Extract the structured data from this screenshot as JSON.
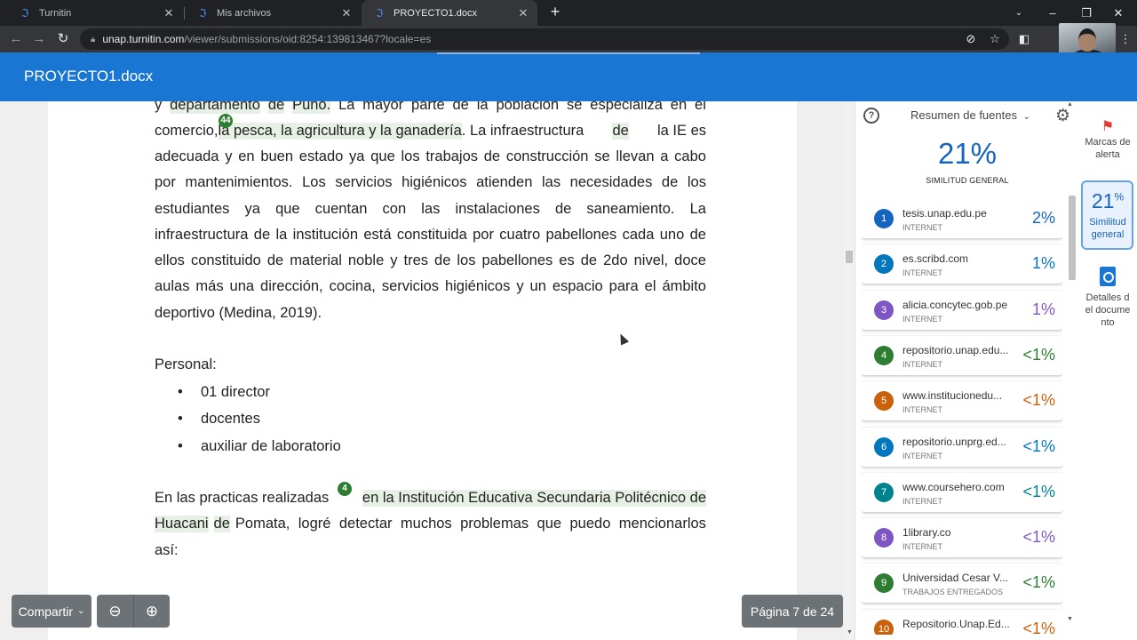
{
  "browser": {
    "tabs": [
      {
        "label": "Turnitin",
        "close": "✕"
      },
      {
        "label": "Mis archivos",
        "close": "✕"
      },
      {
        "label": "PROYECTO1.docx",
        "close": "✕"
      }
    ],
    "new_tab": "+",
    "url_host": "unap.turnitin.com",
    "url_path": "/viewer/submissions/oid:8254:139813467?locale=es"
  },
  "header": {
    "title": "PROYECTO1.docx"
  },
  "document": {
    "line1": [
      "y",
      "departamento",
      "de",
      "Puno.",
      "La",
      "mayor",
      "parte",
      "de",
      "la",
      "población",
      "se",
      "especializa",
      "en",
      "el"
    ],
    "line2_pre": "comercio,",
    "line2_hl": "la pesca, la agricultura y la ganadería",
    "line2_post": ". La infraestructura",
    "line2_hl2": "de",
    "line2_end": "la IE es",
    "line3": [
      "adecuada",
      "y",
      "en",
      "buen",
      "estado",
      "ya",
      "que",
      "los",
      "trabajos",
      "de",
      "construcción",
      "se",
      "llevan",
      "a",
      "cabo"
    ],
    "line4": [
      "por",
      "mantenimientos.",
      "Los",
      "servicios",
      "higiénicos",
      "atienden",
      "las",
      "necesidades",
      "de",
      "los"
    ],
    "line5": [
      "estudiantes",
      "ya",
      "que",
      "cuentan",
      "con",
      "las",
      "instalaciones",
      "de",
      "saneamiento.",
      "La"
    ],
    "line6": [
      "infraestructura",
      "de",
      "la",
      "institución",
      "está",
      "constituida",
      "por",
      "cuatro",
      "pabellones",
      "cada",
      "uno",
      "de"
    ],
    "line7": [
      "ellos",
      "constituido",
      "de",
      "material",
      "noble",
      "y",
      "tres",
      "de",
      "los",
      "pabellones",
      "es",
      "de",
      "2do",
      "nivel,",
      "doce"
    ],
    "line8": [
      "aulas",
      "más",
      "una",
      "dirección,",
      "cocina,",
      "servicios",
      "higiénicos",
      "y",
      "un",
      "espacio",
      "para",
      "el",
      "ámbito"
    ],
    "line9": "deportivo (Medina, 2019).",
    "personal_heading": "Personal:",
    "bullets": [
      "01 director",
      "docentes",
      "auxiliar de laboratorio"
    ],
    "para2_line1_pre": "En las practicas realizadas",
    "para2_line1_hl": "en la Institución Educativa Secundaria Politécnico de",
    "para2_line2_hl": "Huacani",
    "para2_line2_mid": "de",
    "para2_line2_post": "Pomata, logré detectar muchos problemas que puedo mencionarlos",
    "para2_line3": "así:",
    "marker_a": "44",
    "marker_b": "4"
  },
  "controls": {
    "share": "Compartir",
    "page_indicator": "Página 7 de 24"
  },
  "panel": {
    "summary_label": "Resumen de fuentes",
    "overall_pct": "21%",
    "overall_label": "SIMILITUD GENERAL",
    "sources": [
      {
        "n": "1",
        "name": "tesis.unap.edu.pe",
        "type": "INTERNET",
        "pct": "2%",
        "color": "#1565c0",
        "pct_color": "#1565c0"
      },
      {
        "n": "2",
        "name": "es.scribd.com",
        "type": "INTERNET",
        "pct": "1%",
        "color": "#0277bd",
        "pct_color": "#0277bd"
      },
      {
        "n": "3",
        "name": "alicia.concytec.gob.pe",
        "type": "INTERNET",
        "pct": "1%",
        "color": "#7e57c2",
        "pct_color": "#7e57c2"
      },
      {
        "n": "4",
        "name": "repositorio.unap.edu...",
        "type": "INTERNET",
        "pct": "<1%",
        "color": "#2e7d32",
        "pct_color": "#2e7d32"
      },
      {
        "n": "5",
        "name": "www.institucionedu...",
        "type": "INTERNET",
        "pct": "<1%",
        "color": "#c8610a",
        "pct_color": "#c8610a"
      },
      {
        "n": "6",
        "name": "repositorio.unprg.ed...",
        "type": "INTERNET",
        "pct": "<1%",
        "color": "#0277bd",
        "pct_color": "#0277bd"
      },
      {
        "n": "7",
        "name": "www.coursehero.com",
        "type": "INTERNET",
        "pct": "<1%",
        "color": "#00838f",
        "pct_color": "#00838f"
      },
      {
        "n": "8",
        "name": "1library.co",
        "type": "INTERNET",
        "pct": "<1%",
        "color": "#7e57c2",
        "pct_color": "#7e57c2"
      },
      {
        "n": "9",
        "name": "Universidad Cesar V...",
        "type": "TRABAJOS ENTREGADOS",
        "pct": "<1%",
        "color": "#2e7d32",
        "pct_color": "#2e7d32"
      },
      {
        "n": "10",
        "name": "Repositorio.Unap.Ed...",
        "type": "INTERNET",
        "pct": "<1%",
        "color": "#c8610a",
        "pct_color": "#c8610a"
      }
    ]
  },
  "rail": {
    "flags_label": "Marcas de alerta",
    "active_pct": "21",
    "active_sup": "%",
    "active_label": "Similitud general",
    "details_label": "Detalles del documento"
  }
}
